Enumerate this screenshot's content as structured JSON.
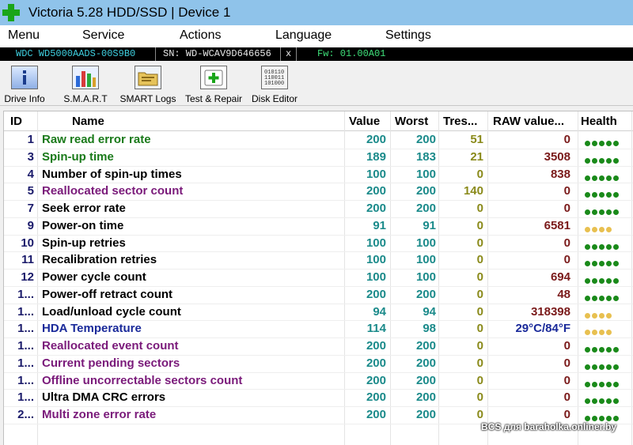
{
  "window": {
    "title": "Victoria 5.28 HDD/SSD | Device 1"
  },
  "menu": [
    "Menu",
    "Service",
    "Actions",
    "Language",
    "Settings"
  ],
  "device": {
    "model": "WDC WD5000AADS-00S9B0",
    "serial": "SN: WD-WCAV9D646656",
    "close": "x",
    "firmware": "Fw: 01.00A01"
  },
  "toolbar": [
    {
      "label": "Drive Info",
      "icon": "info-icon"
    },
    {
      "label": "S.M.A.R.T",
      "icon": "smart-bars-icon"
    },
    {
      "label": "SMART Logs",
      "icon": "folder-icon"
    },
    {
      "label": "Test & Repair",
      "icon": "first-aid-icon"
    },
    {
      "label": "Disk Editor",
      "icon": "binary-icon"
    }
  ],
  "table": {
    "columns": [
      "ID",
      "Name",
      "Value",
      "Worst",
      "Tres...",
      "RAW value...",
      "Health"
    ],
    "rows": [
      {
        "id": "1",
        "name": "Raw read error rate",
        "value": "200",
        "worst": "200",
        "tres": "51",
        "raw": "0",
        "health": 5,
        "color": "#1a7a1a"
      },
      {
        "id": "3",
        "name": "Spin-up time",
        "value": "189",
        "worst": "183",
        "tres": "21",
        "raw": "3508",
        "health": 5,
        "color": "#1a7a1a"
      },
      {
        "id": "4",
        "name": "Number of spin-up times",
        "value": "100",
        "worst": "100",
        "tres": "0",
        "raw": "838",
        "health": 5,
        "color": "#000000"
      },
      {
        "id": "5",
        "name": "Reallocated sector count",
        "value": "200",
        "worst": "200",
        "tres": "140",
        "raw": "0",
        "health": 5,
        "color": "#7a1a7a"
      },
      {
        "id": "7",
        "name": "Seek error rate",
        "value": "200",
        "worst": "200",
        "tres": "0",
        "raw": "0",
        "health": 5,
        "color": "#000000"
      },
      {
        "id": "9",
        "name": "Power-on time",
        "value": "91",
        "worst": "91",
        "tres": "0",
        "raw": "6581",
        "health": 4,
        "color": "#000000"
      },
      {
        "id": "10",
        "name": "Spin-up retries",
        "value": "100",
        "worst": "100",
        "tres": "0",
        "raw": "0",
        "health": 5,
        "color": "#000000"
      },
      {
        "id": "11",
        "name": "Recalibration retries",
        "value": "100",
        "worst": "100",
        "tres": "0",
        "raw": "0",
        "health": 5,
        "color": "#000000"
      },
      {
        "id": "12",
        "name": "Power cycle count",
        "value": "100",
        "worst": "100",
        "tres": "0",
        "raw": "694",
        "health": 5,
        "color": "#000000"
      },
      {
        "id": "1...",
        "name": "Power-off retract count",
        "value": "200",
        "worst": "200",
        "tres": "0",
        "raw": "48",
        "health": 5,
        "color": "#000000"
      },
      {
        "id": "1...",
        "name": "Load/unload cycle count",
        "value": "94",
        "worst": "94",
        "tres": "0",
        "raw": "318398",
        "health": 4,
        "color": "#000000"
      },
      {
        "id": "1...",
        "name": "HDA Temperature",
        "value": "114",
        "worst": "98",
        "tres": "0",
        "raw": "29°C/84°F",
        "health": 4,
        "color": "#1a2a9a",
        "raw_color": "#1a2a9a"
      },
      {
        "id": "1...",
        "name": "Reallocated event count",
        "value": "200",
        "worst": "200",
        "tres": "0",
        "raw": "0",
        "health": 5,
        "color": "#7a1a7a"
      },
      {
        "id": "1...",
        "name": "Current pending sectors",
        "value": "200",
        "worst": "200",
        "tres": "0",
        "raw": "0",
        "health": 5,
        "color": "#7a1a7a"
      },
      {
        "id": "1...",
        "name": "Offline uncorrectable sectors count",
        "value": "200",
        "worst": "200",
        "tres": "0",
        "raw": "0",
        "health": 5,
        "color": "#7a1a7a"
      },
      {
        "id": "1...",
        "name": "Ultra DMA CRC errors",
        "value": "200",
        "worst": "200",
        "tres": "0",
        "raw": "0",
        "health": 5,
        "color": "#000000"
      },
      {
        "id": "2...",
        "name": "Multi zone error rate",
        "value": "200",
        "worst": "200",
        "tres": "0",
        "raw": "0",
        "health": 5,
        "color": "#7a1a7a"
      }
    ]
  },
  "colors": {
    "value": "#1a8a8a",
    "tres": "#8a8a1a",
    "raw": "#7a1a1a",
    "health_good": "#1a8a1a",
    "health_warn": "#e8c050",
    "id": "#1a1a6a"
  },
  "watermark": "BCS для baraholka.onliner.by"
}
